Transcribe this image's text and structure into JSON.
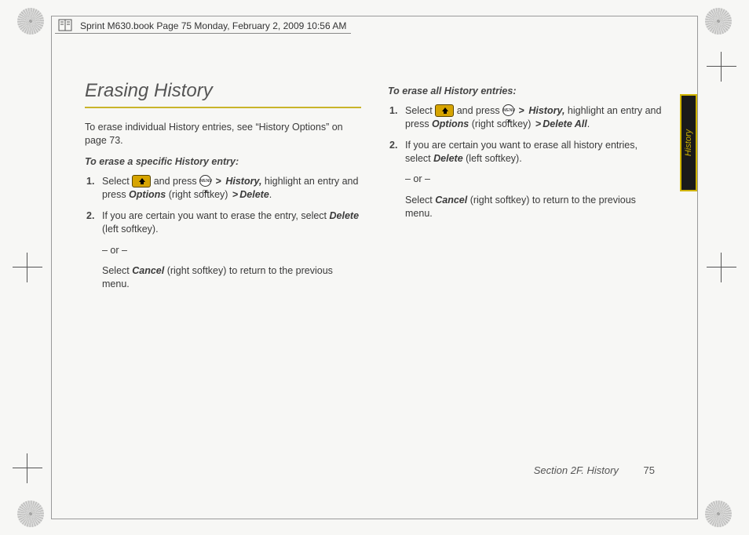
{
  "header": {
    "text": "Sprint M630.book  Page 75  Monday, February 2, 2009  10:56 AM"
  },
  "side_tab": {
    "label": "History"
  },
  "footer": {
    "section": "Section 2F. History",
    "page": "75"
  },
  "left": {
    "title": "Erasing History",
    "intro": "To erase individual History entries, see “History Options” on page 73.",
    "subhead": "To erase a specific History entry:",
    "step1_a": "Select ",
    "step1_b": " and press ",
    "step1_hist": "History,",
    "step1_c": " highlight an entry and press ",
    "step1_opt": "Options",
    "step1_d": " (right softkey) ",
    "step1_del": "Delete",
    "step1_e": ".",
    "step2_a": "If you are certain you want to erase the entry, select ",
    "step2_del": "Delete",
    "step2_b": " (left softkey).",
    "or": "– or –",
    "alt_a": "Select ",
    "alt_cancel": "Cancel",
    "alt_b": " (right softkey) to return to the previous menu."
  },
  "right": {
    "subhead": "To erase all History entries:",
    "step1_a": "Select ",
    "step1_b": " and press ",
    "step1_hist": "History,",
    "step1_c": " highlight an entry and press ",
    "step1_opt": "Options",
    "step1_d": " (right softkey) ",
    "step1_del": "Delete All",
    "step1_e": ".",
    "step2_a": "If you are certain you want to erase all history entries, select ",
    "step2_del": "Delete",
    "step2_b": " (left softkey).",
    "or": "– or –",
    "alt_a": "Select ",
    "alt_cancel": "Cancel",
    "alt_b": " (right softkey) to return to the previous menu."
  },
  "nums": {
    "one": "1.",
    "two": "2."
  },
  "menu_key_label": "MENU OK"
}
